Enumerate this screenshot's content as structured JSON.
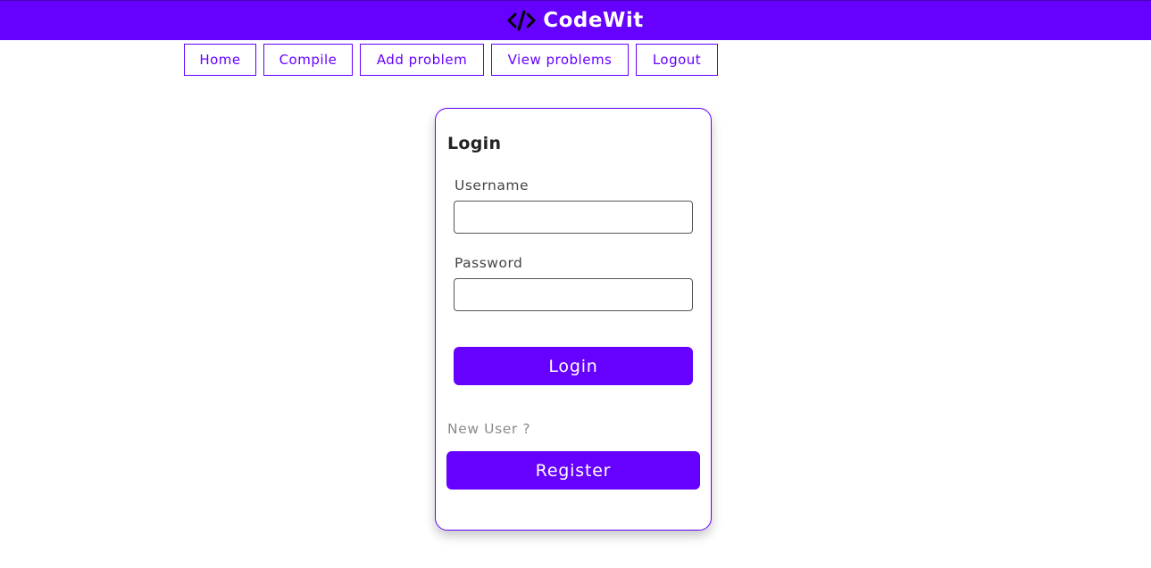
{
  "header": {
    "brand_icon": "code-icon",
    "brand_title": "CodeWit",
    "color": "#6600ff"
  },
  "nav": {
    "items": [
      {
        "label": "Home"
      },
      {
        "label": "Compile"
      },
      {
        "label": "Add problem"
      },
      {
        "label": "View problems"
      },
      {
        "label": "Logout"
      }
    ]
  },
  "login_form": {
    "title": "Login",
    "username_label": "Username",
    "username_value": "",
    "password_label": "Password",
    "password_value": "",
    "login_button": "Login",
    "new_user_text": "New User ?",
    "register_button": "Register"
  }
}
